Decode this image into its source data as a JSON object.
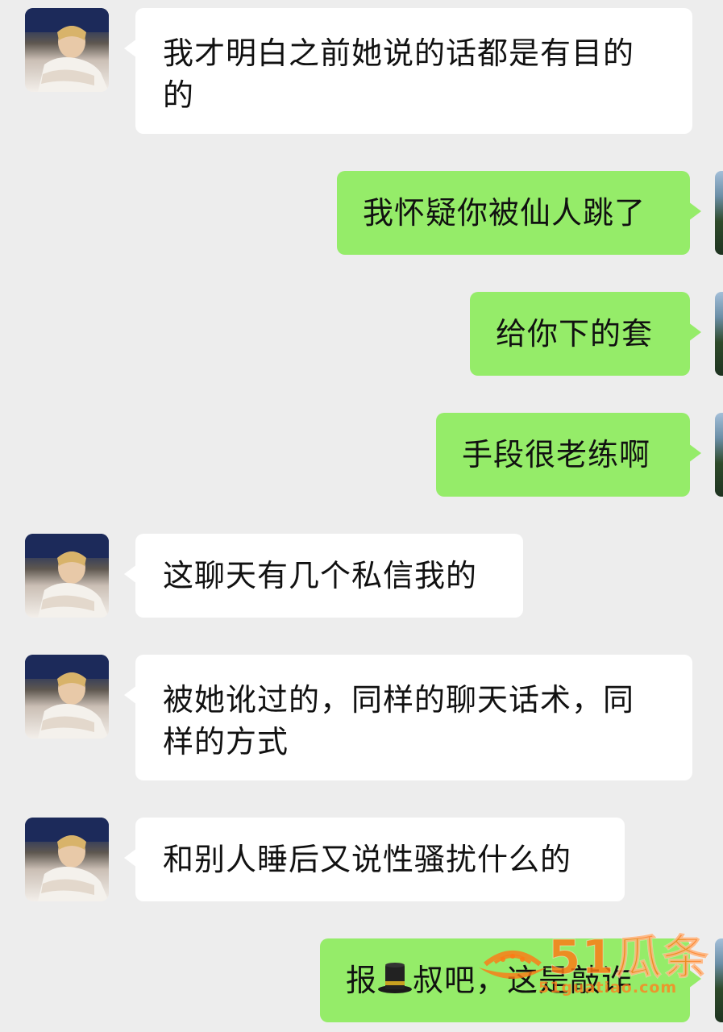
{
  "messages": [
    {
      "side": "in",
      "text": "我才明白之前她说的话都是有目的的"
    },
    {
      "side": "out",
      "text": "我怀疑你被仙人跳了"
    },
    {
      "side": "out",
      "text": "给你下的套"
    },
    {
      "side": "out",
      "text": "手段很老练啊"
    },
    {
      "side": "in",
      "text": "这聊天有几个私信我的"
    },
    {
      "side": "in",
      "text": "被她讹过的，同样的聊天话术，同样的方式"
    },
    {
      "side": "in",
      "text": "和别人睡后又说性骚扰什么的"
    },
    {
      "side": "out",
      "text_before": "报",
      "emoji": "top-hat-emoji",
      "text_after": "叔吧，这是敲诈"
    }
  ],
  "watermark": {
    "brand": "51瓜条",
    "url": "51guatiao.com",
    "color": "#ff7a14"
  },
  "colors": {
    "background": "#ededed",
    "incoming_bubble": "#ffffff",
    "outgoing_bubble": "#95ec69"
  }
}
